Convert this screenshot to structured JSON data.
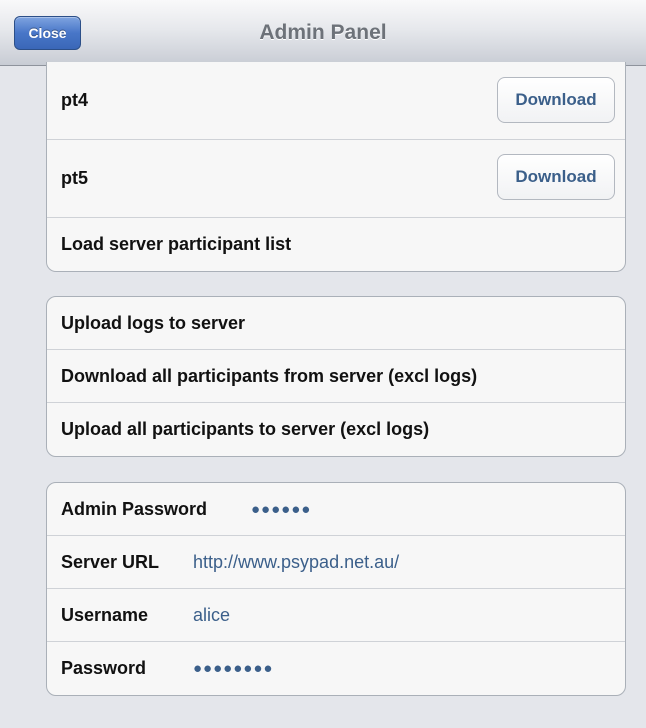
{
  "navbar": {
    "close_label": "Close",
    "title": "Admin Panel"
  },
  "participants": {
    "items": [
      {
        "label": "pt4",
        "button_label": "Download"
      },
      {
        "label": "pt5",
        "button_label": "Download"
      }
    ],
    "load_label": "Load server participant list"
  },
  "server_actions": {
    "upload_logs": "Upload logs to server",
    "download_all": "Download all participants from server (excl logs)",
    "upload_all": "Upload all participants to server (excl logs)"
  },
  "settings": {
    "admin_password_label": "Admin Password",
    "admin_password_value": "●●●●●●",
    "server_url_label": "Server URL",
    "server_url_value": "http://www.psypad.net.au/",
    "username_label": "Username",
    "username_value": "alice",
    "password_label": "Password",
    "password_value": "●●●●●●●●"
  },
  "colors": {
    "accent": "#3b5f8a",
    "close_button": "#4876c8",
    "background": "#e4e6eb"
  }
}
